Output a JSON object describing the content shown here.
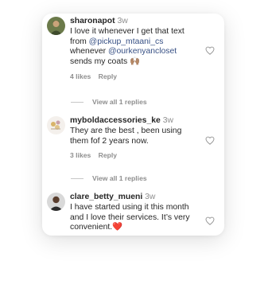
{
  "comments": [
    {
      "username": "sharonapot",
      "time": "3w",
      "text_parts": [
        "I love it whenever I get that text from ",
        "@pickup_mtaani_cs",
        " whenever ",
        "@ourkenyancloset",
        " sends my coats 🙌🏽"
      ],
      "likes": "4 likes",
      "reply": "Reply",
      "view_replies": "View all 1 replies"
    },
    {
      "username": "myboldaccessories_ke",
      "time": "3w",
      "text": "They are the best , been using them fof 2 years now.",
      "likes": "3 likes",
      "reply": "Reply",
      "view_replies": "View all 1 replies"
    },
    {
      "username": "clare_betty_mueni",
      "time": "3w",
      "text": "I have started using it this month and I love their services. It’s very convenient.❤️"
    }
  ],
  "icons": {
    "like": "heart-outline-icon"
  }
}
